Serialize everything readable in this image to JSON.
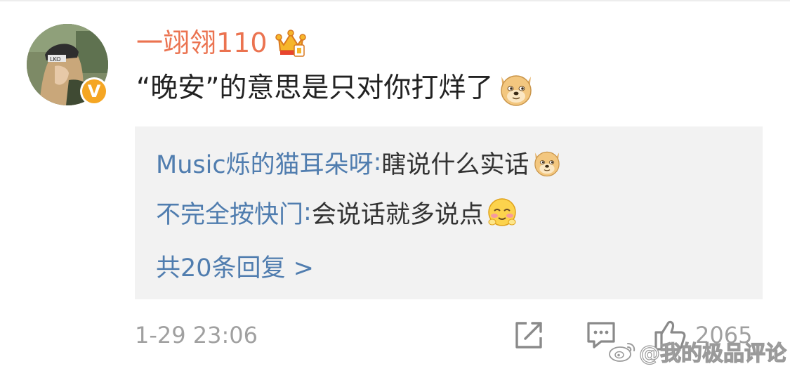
{
  "comment": {
    "username": "一翊翎110",
    "text": "“晚安”的意思是只对你打烊了",
    "timestamp": "1-29 23:06",
    "like_count": "2065",
    "icons": {
      "avatar": "avatar-photo",
      "verified": "verified-badge",
      "crown": "crown-member-icon",
      "emoji": "doge-emoji"
    }
  },
  "replies": {
    "items": [
      {
        "author": "Music烁的猫耳朵呀",
        "separator": ": ",
        "text": "瞎说什么实话",
        "emoji": "doge-emoji"
      },
      {
        "author": "不完全按快门",
        "separator": ": ",
        "text": "会说话就多说点",
        "emoji": "blush-emoji"
      }
    ],
    "more_label": "共20条回复 >"
  },
  "actions": {
    "share_icon": "share-icon",
    "comment_icon": "comment-icon",
    "like_icon": "thumbs-up-icon"
  },
  "watermark": {
    "text": "@我的极品评论",
    "icon": "weibo-logo-icon"
  },
  "colors": {
    "username": "#eb7350",
    "link": "#507daf",
    "text": "#222222",
    "muted": "#a0a0a0",
    "reply_bg": "#f2f2f2",
    "badge": "#f5a623"
  }
}
